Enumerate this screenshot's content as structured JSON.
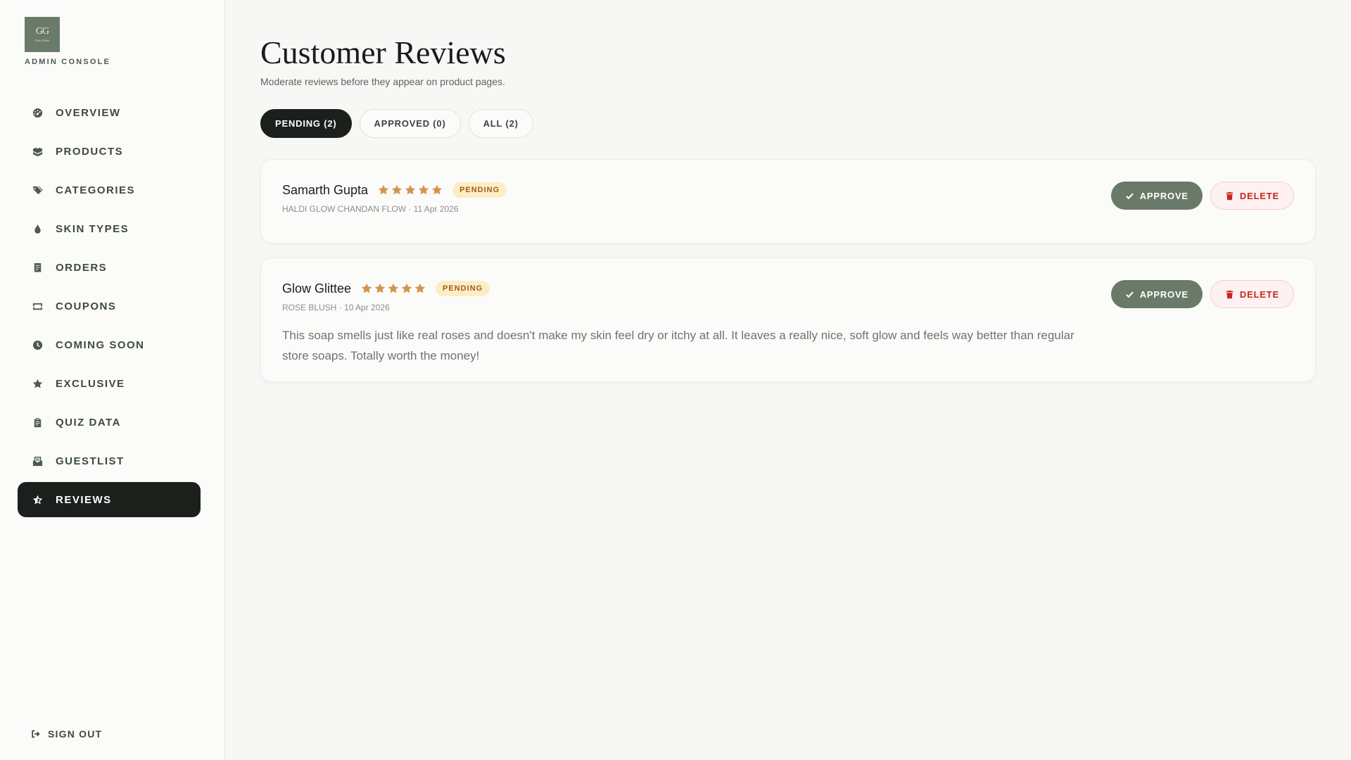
{
  "brand": {
    "monogram": "GG",
    "logo_subtext": "Glow Glitter",
    "caption": "ADMIN CONSOLE"
  },
  "sidebar": {
    "items": [
      {
        "label": "OVERVIEW",
        "icon": "gauge-icon",
        "active": false
      },
      {
        "label": "PRODUCTS",
        "icon": "boxes-icon",
        "active": false
      },
      {
        "label": "CATEGORIES",
        "icon": "tags-icon",
        "active": false
      },
      {
        "label": "SKIN TYPES",
        "icon": "droplet-icon",
        "active": false
      },
      {
        "label": "ORDERS",
        "icon": "receipt-icon",
        "active": false
      },
      {
        "label": "COUPONS",
        "icon": "ticket-icon",
        "active": false
      },
      {
        "label": "COMING SOON",
        "icon": "clock-icon",
        "active": false
      },
      {
        "label": "EXCLUSIVE",
        "icon": "star-icon",
        "active": false
      },
      {
        "label": "QUIZ DATA",
        "icon": "clipboard-icon",
        "active": false
      },
      {
        "label": "GUESTLIST",
        "icon": "inbox-icon",
        "active": false
      },
      {
        "label": "REVIEWS",
        "icon": "star-half-icon",
        "active": true
      }
    ],
    "signout_label": "SIGN OUT"
  },
  "header": {
    "title": "Customer Reviews",
    "subtitle": "Moderate reviews before they appear on product pages."
  },
  "filters": [
    {
      "label": "PENDING (2)",
      "active": true
    },
    {
      "label": "APPROVED (0)",
      "active": false
    },
    {
      "label": "ALL (2)",
      "active": false
    }
  ],
  "reviews": [
    {
      "name": "Samarth Gupta",
      "rating": 5,
      "status": "PENDING",
      "meta": "HALDI GLOW CHANDAN FLOW · 11 Apr 2026",
      "text": ""
    },
    {
      "name": "Glow Glittee",
      "rating": 5,
      "status": "PENDING",
      "meta": "ROSE BLUSH · 10 Apr 2026",
      "text": "This soap smells just like real roses and doesn't make my skin feel dry or itchy at all. It leaves a really nice, soft glow and feels way better than regular store soaps. Totally worth the money!"
    }
  ],
  "actions": {
    "approve_label": "APPROVE",
    "delete_label": "DELETE"
  },
  "colors": {
    "accent_dark": "#1c201d",
    "sage": "#6a7a69",
    "star": "#d4944a",
    "pending_bg": "#fbeec5",
    "pending_text": "#a4571c",
    "danger": "#c8271f"
  }
}
